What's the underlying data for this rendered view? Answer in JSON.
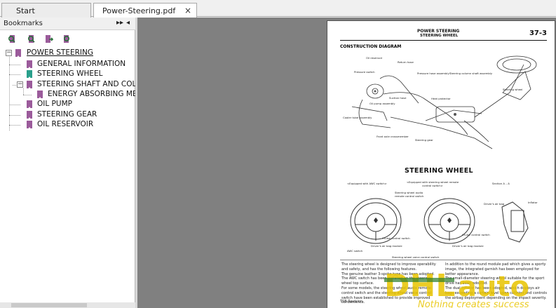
{
  "tabs": [
    {
      "label": "Start"
    },
    {
      "label": "Power-Steering.pdf",
      "close": "×"
    }
  ],
  "sidebar": {
    "title": "Bookmarks",
    "collapse_icon": "▸▸",
    "close_icon": "◂"
  },
  "bookmarks": {
    "root": "POWER STEERING",
    "items": [
      {
        "label": "GENERAL INFORMATION"
      },
      {
        "label": "STEERING WHEEL"
      },
      {
        "label": "STEERING SHAFT AND COLUMI"
      },
      {
        "label": "ENERGY ABSORBING MECH/"
      },
      {
        "label": "OIL PUMP"
      },
      {
        "label": "STEERING GEAR"
      },
      {
        "label": "OIL RESERVOIR"
      }
    ]
  },
  "page": {
    "section": "POWER STEERING",
    "subsection": "STEERING WHEEL",
    "page_number": "37-3",
    "construction_title": "CONSTRUCTION DIAGRAM",
    "diagram_labels": {
      "oil_reservoir": "Oil reservoir",
      "return_hose": "Return hose",
      "pressure_switch": "Pressure switch",
      "pressure_hose": "Pressure hose assembly",
      "column_shaft": "Steering column shaft assembly",
      "suction_hose": "Suction hose",
      "oil_pump": "Oil pump assembly",
      "heat_protector": "Heat protector",
      "cooler_tube": "Cooler tube assembly",
      "steering_wheel": "Steering wheel",
      "crossmember": "Front axle crossmember",
      "steering_gear": "Steering gear"
    },
    "steering_title": "STEERING WHEEL",
    "awc_left": "<Equipped with AWC switch>",
    "awc_right": "<Equipped with steering wheel remote control switch>",
    "section_aa": "Section A – A",
    "audio_switch": "Steering wheel audio remote control switch",
    "driver_bag": "Driver's air bag",
    "inflator": "Inflator",
    "cruise_left": "Cruise control switch",
    "cruise_right": "Cruise control switch",
    "awc_switch": "AWC switch",
    "bag_module_l": "Driver's air bag module",
    "bag_module_r": "Driver's air bag module",
    "voice_switch": "Steering wheel voice control switch",
    "body_left": "The steering wheel is designed to improve operability and safety, and has the following features.",
    "bullet1": "The genuine leather 3-spoke type has been adopted.",
    "bullet2": "The AWC switch has been installed on the steering wheel top surface.",
    "bullet3": "For some models, the steering wheel audio remote control switch and the steering wheel voice control switch have been established to provide improved convenience.",
    "body_right1": "In addition to the round module pad which gives a sporty image, the integrated garnish has been employed for better appearance.",
    "body_right2": "The small-diameter steering wheel suitable for the sport drive has been adopted.",
    "body_right3": "The dual inflator has been adopted, which deploys air bags exceeding a certain level upon collision and controls the airbag deployment depending on the impact severity.",
    "footer": "TSB Revision"
  },
  "watermark": {
    "brand": "DHLauto",
    "tagline": "Nothing creates success"
  },
  "colors": {
    "bookmark_purple": "#9b5b9b",
    "bookmark_teal": "#2aa08c",
    "viewer_bg": "#808080"
  }
}
